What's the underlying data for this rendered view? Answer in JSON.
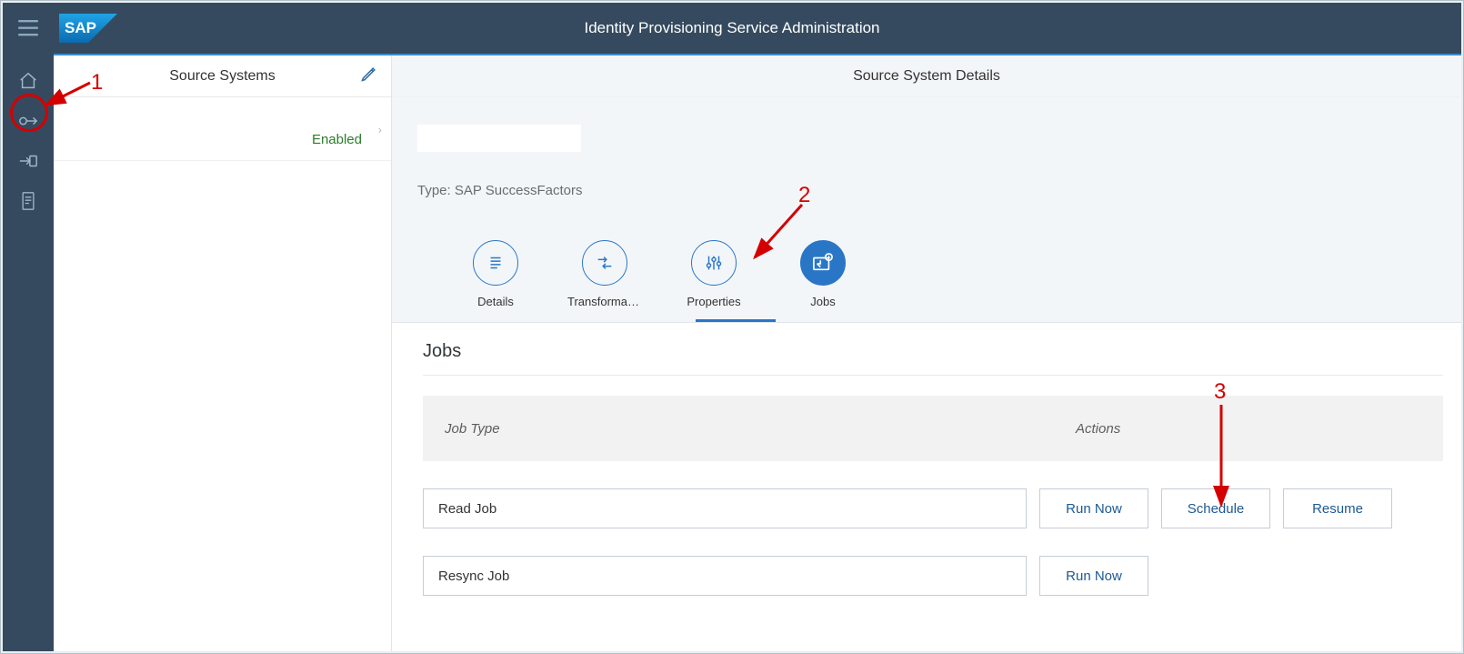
{
  "header": {
    "title": "Identity Provisioning Service Administration",
    "logo_text": "SAP"
  },
  "leftRail": {
    "items": [
      {
        "name": "home-icon"
      },
      {
        "name": "source-systems-icon"
      },
      {
        "name": "target-systems-icon"
      },
      {
        "name": "logs-icon"
      }
    ]
  },
  "listPanel": {
    "title": "Source Systems",
    "rows": [
      {
        "status": "Enabled"
      }
    ]
  },
  "detailsPanel": {
    "title": "Source System Details",
    "type_line": "Type: SAP SuccessFactors",
    "tabs": [
      {
        "label": "Details",
        "name": "tab-details"
      },
      {
        "label": "Transformati…",
        "name": "tab-transformation"
      },
      {
        "label": "Properties",
        "name": "tab-properties"
      },
      {
        "label": "Jobs",
        "name": "tab-jobs",
        "active": true
      }
    ]
  },
  "jobs": {
    "section_title": "Jobs",
    "columns": {
      "type": "Job Type",
      "actions": "Actions"
    },
    "rows": [
      {
        "name": "Read Job",
        "buttons": [
          "Run Now",
          "Schedule",
          "Resume"
        ]
      },
      {
        "name": "Resync Job",
        "buttons": [
          "Run Now"
        ]
      }
    ]
  },
  "annotations": {
    "n1": "1",
    "n2": "2",
    "n3": "3"
  },
  "icons": {
    "hamburger": "☰",
    "home": "⌂",
    "chevron_right": "›"
  }
}
